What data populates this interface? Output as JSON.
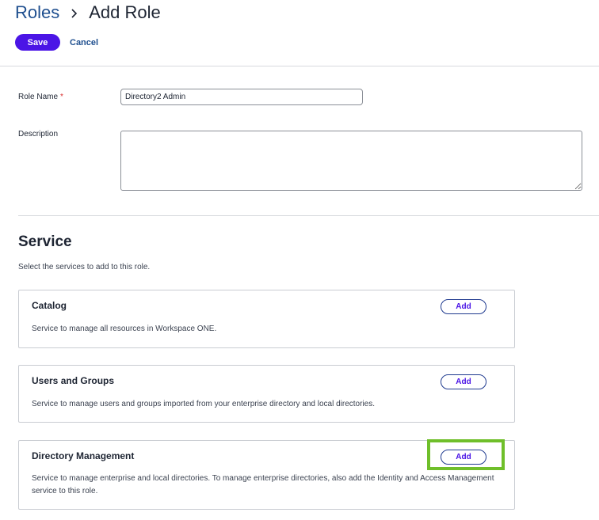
{
  "breadcrumb": {
    "parent": "Roles",
    "current": "Add Role"
  },
  "actions": {
    "save_label": "Save",
    "cancel_label": "Cancel"
  },
  "form": {
    "role_name_label": "Role Name",
    "required_marker": "*",
    "role_name_value": "Directory2 Admin",
    "description_label": "Description",
    "description_value": ""
  },
  "service": {
    "title": "Service",
    "subtitle": "Select the services to add to this role.",
    "cards": [
      {
        "title": "Catalog",
        "description": "Service to manage all resources in Workspace ONE.",
        "add_label": "Add"
      },
      {
        "title": "Users and Groups",
        "description": "Service to manage users and groups imported from your enterprise directory and local directories.",
        "add_label": "Add"
      },
      {
        "title": "Directory Management",
        "description": "Service to manage enterprise and local directories. To manage enterprise directories, also add the Identity and Access Management service to this role.",
        "add_label": "Add"
      }
    ]
  },
  "colors": {
    "primary": "#4b15e6",
    "link": "#1f4f8f",
    "highlight": "#6fbf2a",
    "required": "#d92e2e"
  },
  "icons": {
    "breadcrumb_separator": "chevron-right-icon",
    "textarea_resize": "resize-grip-icon"
  }
}
